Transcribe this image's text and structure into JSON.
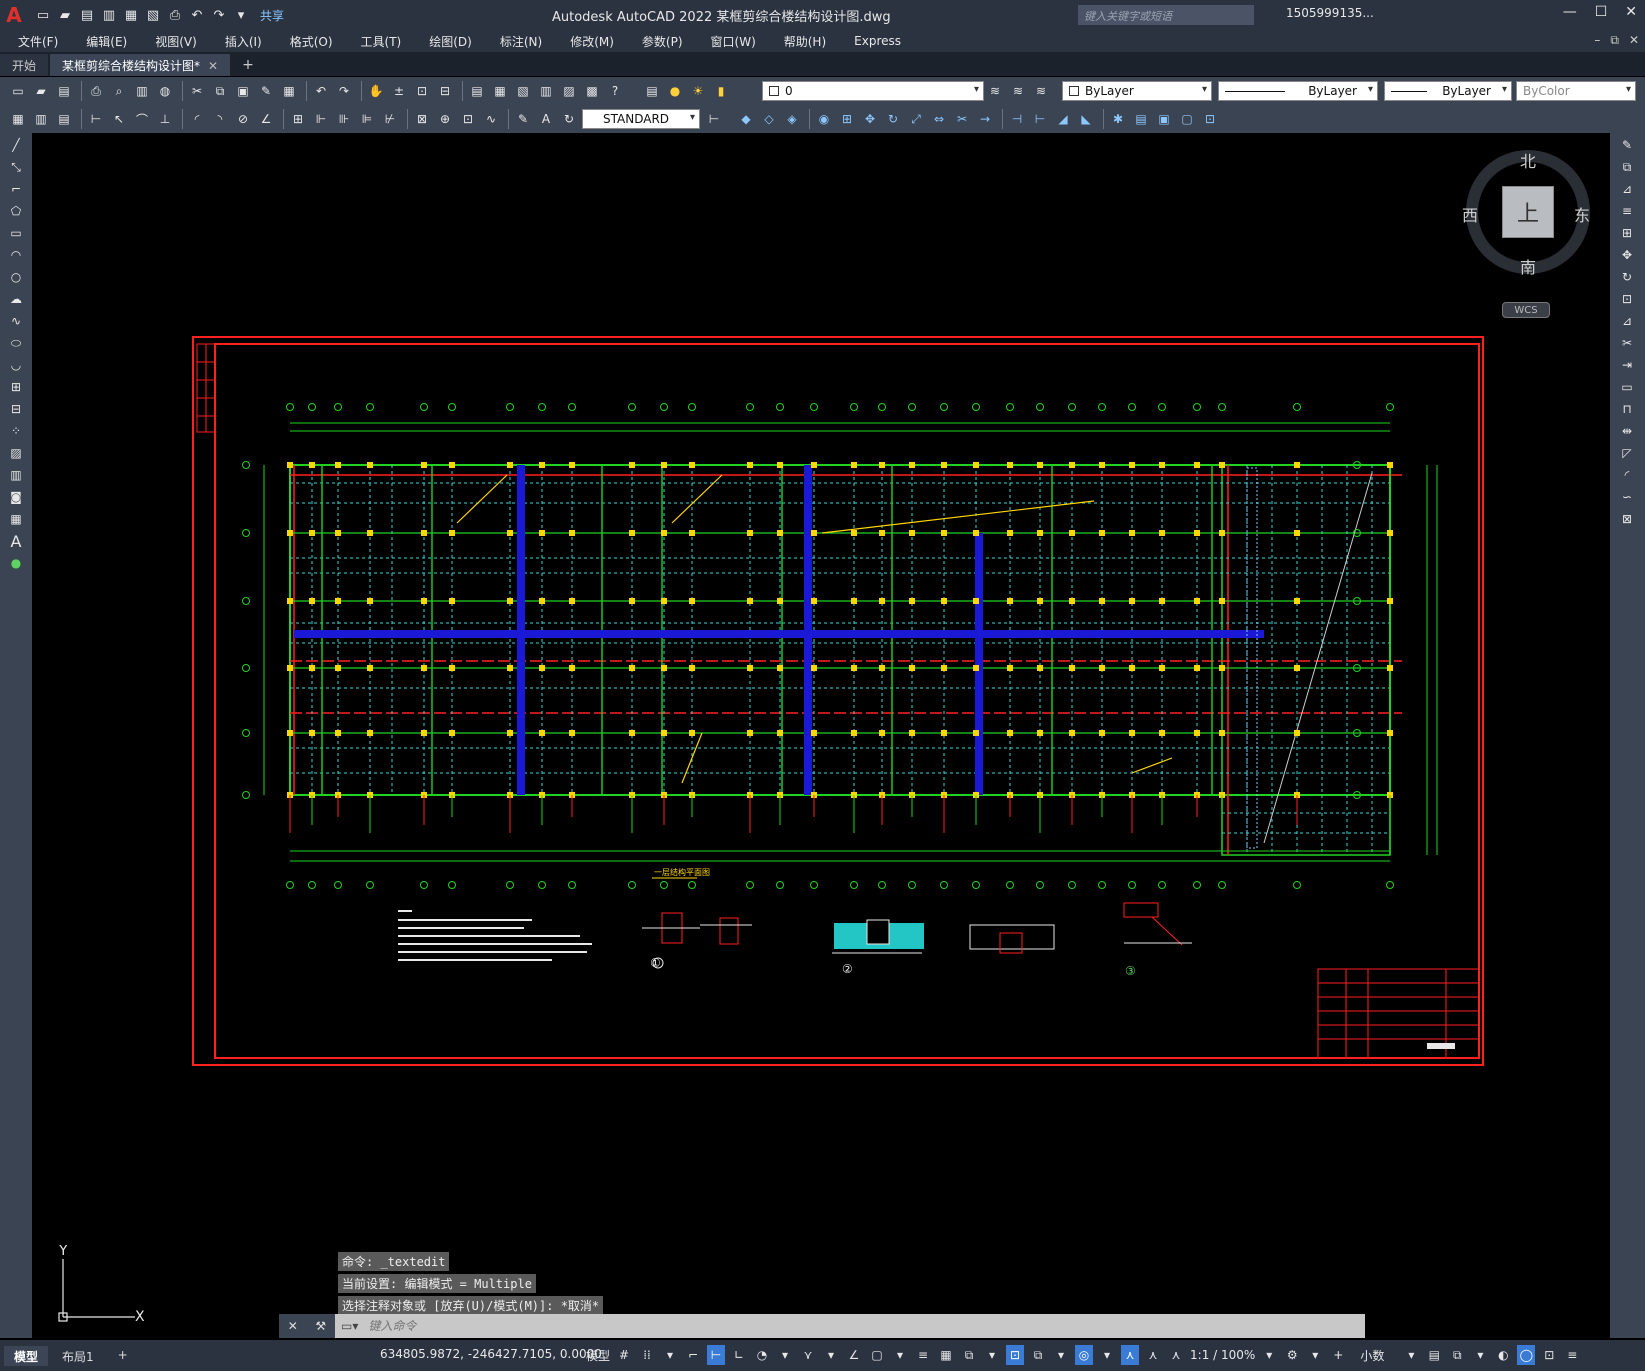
{
  "app": {
    "logo": "A",
    "title": "Autodesk AutoCAD 2022    某框剪综合楼结构设计图.dwg",
    "share_label": "共享",
    "search_placeholder": "键入关键字或短语",
    "user": "1505999135...",
    "window_controls": [
      "—",
      "☐",
      "✕"
    ]
  },
  "menu": {
    "items": [
      "文件(F)",
      "编辑(E)",
      "视图(V)",
      "插入(I)",
      "格式(O)",
      "工具(T)",
      "绘图(D)",
      "标注(N)",
      "修改(M)",
      "参数(P)",
      "窗口(W)",
      "帮助(H)",
      "Express"
    ]
  },
  "tabs": {
    "start": "开始",
    "active": "某框剪综合楼结构设计图*",
    "close": "✕",
    "add": "+"
  },
  "toolbar": {
    "layer": "0",
    "color": "ByLayer",
    "linetype": "ByLayer",
    "lineweight": "ByLayer",
    "plotstyle": "ByColor",
    "textstyle": "STANDARD"
  },
  "viewcube": {
    "north": "北",
    "south": "南",
    "east": "东",
    "west": "西",
    "top": "上",
    "wcs": "WCS"
  },
  "command": {
    "history": [
      "命令: _textedit",
      "当前设置: 编辑模式 = Multiple",
      "选择注释对象或 [放弃(U)/模式(M)]: *取消*"
    ],
    "placeholder": "键入命令"
  },
  "ucs": {
    "y": "Y",
    "x": "X"
  },
  "status": {
    "layout_tabs": [
      "模型",
      "布局1"
    ],
    "add_tab": "+",
    "coords": "634805.9872, -246427.7105, 0.0000",
    "model": "模型",
    "scale": "1:1 / 100%",
    "units": "小数"
  },
  "drawing": {
    "title_label": "一层结构平面图",
    "detail_labels": [
      "①",
      "②",
      "③"
    ]
  }
}
